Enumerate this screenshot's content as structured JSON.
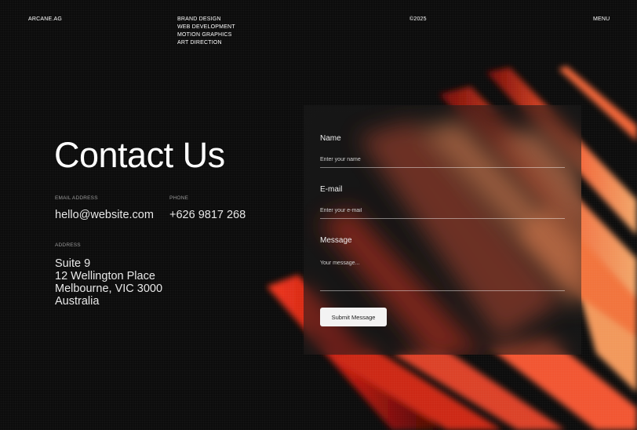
{
  "header": {
    "brand": "ARCANE.AG",
    "services": [
      "BRAND DESIGN",
      "WEB DEVELOPMENT",
      "MOTION GRAPHICS",
      "ART DIRECTION"
    ],
    "year": "©2025",
    "menu_label": "MENU"
  },
  "contact": {
    "title": "Contact Us",
    "email_label": "EMAIL ADDRESS",
    "email": "hello@website.com",
    "phone_label": "PHONE",
    "phone": "+626 9817 268",
    "address_label": "ADDRESS",
    "address_lines": [
      "Suite 9",
      "12 Wellington Place",
      "Melbourne, VIC 3000",
      "Australia"
    ]
  },
  "form": {
    "name_label": "Name",
    "name_placeholder": "Enter your name",
    "email_label": "E-mail",
    "email_placeholder": "Enter your e-mail",
    "message_label": "Message",
    "message_placeholder": "Your message...",
    "submit_label": "Submit Message"
  },
  "colors": {
    "background": "#0c0c0c",
    "accent_red": "#e0301e",
    "accent_orange": "#ff8a4a",
    "button_bg": "#f3f3f3"
  }
}
